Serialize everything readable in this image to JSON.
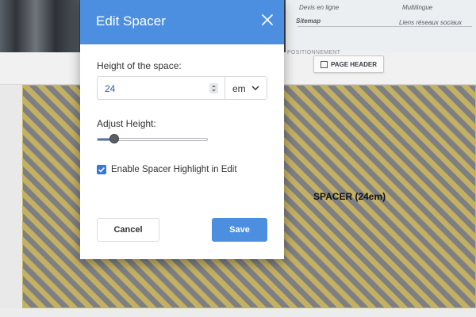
{
  "background": {
    "footer_links": {
      "col1_row1": "Devis en ligne",
      "col2_row1": "Multilingue",
      "col1_row2": "Sitemap",
      "col2_row2": "Liens réseaux sociaux"
    },
    "positioning_label": "POSITIONNEMENT",
    "page_header_button": "PAGE HEADER",
    "spacer_label": "SPACER (24em)",
    "spacer_colors": {
      "stripe_a": "#c4b062",
      "stripe_b": "#7d7f83"
    }
  },
  "modal": {
    "title": "Edit Spacer",
    "header_color": "#4c8fe1",
    "height_label": "Height of the space:",
    "height_value": "24",
    "unit_value": "em",
    "adjust_label": "Adjust Height:",
    "slider_fraction": 0.16,
    "highlight_checkbox": {
      "checked": true,
      "label": "Enable Spacer Highlight in Edit"
    },
    "cancel_label": "Cancel",
    "save_label": "Save"
  },
  "icons": [
    "close-icon",
    "stepper-icon",
    "chevron-down-icon",
    "checkmark-icon"
  ]
}
